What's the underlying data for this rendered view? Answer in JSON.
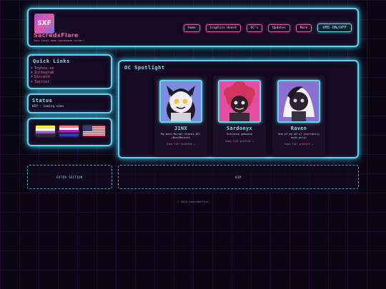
{
  "header": {
    "logo_text": "SXF",
    "title": "SacredxFlare",
    "tagline": "Your local neon synthwave corner!",
    "nav": [
      "Home",
      "Graphics Hoard",
      "OC's",
      "Updates",
      "More"
    ],
    "vhs_label": "VHS ON/OFF"
  },
  "sidebar": {
    "quick_links": {
      "title": "Quick Links",
      "links": [
        "Toyhou.se",
        "Instagram",
        "Discord",
        "Twitter"
      ]
    },
    "status": {
      "title": "Status",
      "text": "WIP - coming soon"
    },
    "flags": [
      "nonbinary-pride-flag",
      "genderfluid-pride-flag",
      "usa-flag"
    ]
  },
  "spotlight": {
    "title": "OC Spotlight",
    "cards": [
      {
        "name": "J1NX",
        "desc": "My main Murder Drones OC!",
        "desc_line2": "(Nva/Menace)",
        "link": "View full profile →"
      },
      {
        "name": "Sardonyx",
        "desc": "OcsCanon gemsona",
        "desc_line2": "",
        "link": "View full profile →"
      },
      {
        "name": "Raven",
        "desc": "One of my OC's! (currently",
        "desc_line2": "auth only)",
        "link": "View full profile →"
      }
    ]
  },
  "extra": {
    "section1": "EXTRA SECTION",
    "section2": "WIP"
  },
  "footer": "© 2025 SacredxFlare",
  "colors": {
    "accent_cyan": "#5fd3e8",
    "accent_pink": "#e45ea6",
    "panel_bg": "#150a22",
    "page_bg": "#0a0512"
  }
}
